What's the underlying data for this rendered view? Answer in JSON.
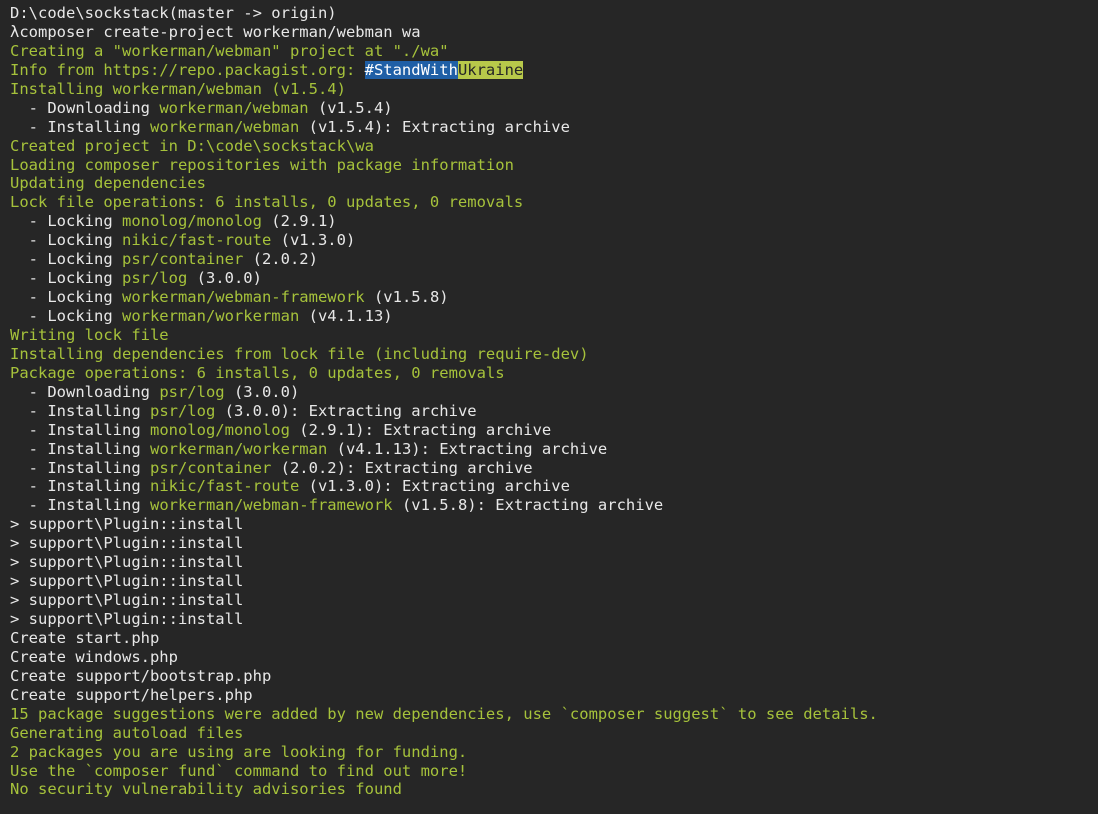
{
  "terminal": {
    "lines": [
      [
        {
          "t": "D:\\code\\sockstack(master -> origin)",
          "c": "w"
        }
      ],
      [
        {
          "t": "λcomposer create-project workerman/webman wa",
          "c": "w"
        }
      ],
      [
        {
          "t": "Creating a \"workerman/webman\" project at \"./wa\"",
          "c": "g"
        }
      ],
      [
        {
          "t": "Info from https://repo.packagist.org: ",
          "c": "g"
        },
        {
          "t": "#StandWith",
          "c": "h1"
        },
        {
          "t": "Ukraine",
          "c": "h2"
        }
      ],
      [
        {
          "t": "Installing workerman/webman (v1.5.4)",
          "c": "g"
        }
      ],
      [
        {
          "t": "  - Downloading ",
          "c": "w"
        },
        {
          "t": "workerman/webman",
          "c": "g"
        },
        {
          "t": " (v1.5.4)",
          "c": "w"
        }
      ],
      [
        {
          "t": "  - Installing ",
          "c": "w"
        },
        {
          "t": "workerman/webman",
          "c": "g"
        },
        {
          "t": " (v1.5.4): Extracting archive",
          "c": "w"
        }
      ],
      [
        {
          "t": "Created project in D:\\code\\sockstack\\wa",
          "c": "g"
        }
      ],
      [
        {
          "t": "Loading composer repositories with package information",
          "c": "g"
        }
      ],
      [
        {
          "t": "Updating dependencies",
          "c": "g"
        }
      ],
      [
        {
          "t": "Lock file operations: 6 installs, 0 updates, 0 removals",
          "c": "g"
        }
      ],
      [
        {
          "t": "  - Locking ",
          "c": "w"
        },
        {
          "t": "monolog/monolog",
          "c": "g"
        },
        {
          "t": " (2.9.1)",
          "c": "w"
        }
      ],
      [
        {
          "t": "  - Locking ",
          "c": "w"
        },
        {
          "t": "nikic/fast-route",
          "c": "g"
        },
        {
          "t": " (v1.3.0)",
          "c": "w"
        }
      ],
      [
        {
          "t": "  - Locking ",
          "c": "w"
        },
        {
          "t": "psr/container",
          "c": "g"
        },
        {
          "t": " (2.0.2)",
          "c": "w"
        }
      ],
      [
        {
          "t": "  - Locking ",
          "c": "w"
        },
        {
          "t": "psr/log",
          "c": "g"
        },
        {
          "t": " (3.0.0)",
          "c": "w"
        }
      ],
      [
        {
          "t": "  - Locking ",
          "c": "w"
        },
        {
          "t": "workerman/webman-framework",
          "c": "g"
        },
        {
          "t": " (v1.5.8)",
          "c": "w"
        }
      ],
      [
        {
          "t": "  - Locking ",
          "c": "w"
        },
        {
          "t": "workerman/workerman",
          "c": "g"
        },
        {
          "t": " (v4.1.13)",
          "c": "w"
        }
      ],
      [
        {
          "t": "Writing lock file",
          "c": "g"
        }
      ],
      [
        {
          "t": "Installing dependencies from lock file (including require-dev)",
          "c": "g"
        }
      ],
      [
        {
          "t": "Package operations: 6 installs, 0 updates, 0 removals",
          "c": "g"
        }
      ],
      [
        {
          "t": "  - Downloading ",
          "c": "w"
        },
        {
          "t": "psr/log",
          "c": "g"
        },
        {
          "t": " (3.0.0)",
          "c": "w"
        }
      ],
      [
        {
          "t": "  - Installing ",
          "c": "w"
        },
        {
          "t": "psr/log",
          "c": "g"
        },
        {
          "t": " (3.0.0): Extracting archive",
          "c": "w"
        }
      ],
      [
        {
          "t": "  - Installing ",
          "c": "w"
        },
        {
          "t": "monolog/monolog",
          "c": "g"
        },
        {
          "t": " (2.9.1): Extracting archive",
          "c": "w"
        }
      ],
      [
        {
          "t": "  - Installing ",
          "c": "w"
        },
        {
          "t": "workerman/workerman",
          "c": "g"
        },
        {
          "t": " (v4.1.13): Extracting archive",
          "c": "w"
        }
      ],
      [
        {
          "t": "  - Installing ",
          "c": "w"
        },
        {
          "t": "psr/container",
          "c": "g"
        },
        {
          "t": " (2.0.2): Extracting archive",
          "c": "w"
        }
      ],
      [
        {
          "t": "  - Installing ",
          "c": "w"
        },
        {
          "t": "nikic/fast-route",
          "c": "g"
        },
        {
          "t": " (v1.3.0): Extracting archive",
          "c": "w"
        }
      ],
      [
        {
          "t": "  - Installing ",
          "c": "w"
        },
        {
          "t": "workerman/webman-framework",
          "c": "g"
        },
        {
          "t": " (v1.5.8): Extracting archive",
          "c": "w"
        }
      ],
      [
        {
          "t": "> support\\Plugin::install",
          "c": "w"
        }
      ],
      [
        {
          "t": "> support\\Plugin::install",
          "c": "w"
        }
      ],
      [
        {
          "t": "> support\\Plugin::install",
          "c": "w"
        }
      ],
      [
        {
          "t": "> support\\Plugin::install",
          "c": "w"
        }
      ],
      [
        {
          "t": "> support\\Plugin::install",
          "c": "w"
        }
      ],
      [
        {
          "t": "> support\\Plugin::install",
          "c": "w"
        }
      ],
      [
        {
          "t": "Create start.php",
          "c": "w"
        }
      ],
      [
        {
          "t": "Create windows.php",
          "c": "w"
        }
      ],
      [
        {
          "t": "Create support/bootstrap.php",
          "c": "w"
        }
      ],
      [
        {
          "t": "Create support/helpers.php",
          "c": "w"
        }
      ],
      [
        {
          "t": "15 package suggestions were added by new dependencies, use `composer suggest` to see details.",
          "c": "g"
        }
      ],
      [
        {
          "t": "Generating autoload files",
          "c": "g"
        }
      ],
      [
        {
          "t": "2 packages you are using are looking for funding.",
          "c": "g"
        }
      ],
      [
        {
          "t": "Use the `composer fund` command to find out more!",
          "c": "g"
        }
      ],
      [
        {
          "t": "No security vulnerability advisories found",
          "c": "g"
        }
      ]
    ]
  }
}
